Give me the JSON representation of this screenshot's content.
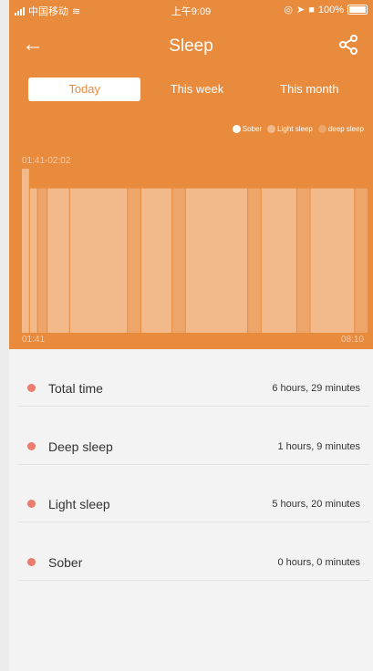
{
  "status_bar": {
    "carrier": "中国移动",
    "time": "上午9:09",
    "battery": "100%"
  },
  "header": {
    "title": "Sleep",
    "back_icon": "arrow-left-icon",
    "share_icon": "share-icon"
  },
  "tabs": [
    {
      "label": "Today",
      "active": true
    },
    {
      "label": "This week",
      "active": false
    },
    {
      "label": "This month",
      "active": false
    }
  ],
  "legend": [
    {
      "label": "Sober",
      "color": "#ffffff"
    },
    {
      "label": "Light sleep",
      "color": "#f2b98b"
    },
    {
      "label": "deep sleep",
      "color": "#eda56a"
    }
  ],
  "chart_data": {
    "type": "bar",
    "x_start": "01:41",
    "x_end": "08:10",
    "selected_range": "01:41-02:02",
    "segments": [
      {
        "state": "Light sleep",
        "start": "01:41",
        "end": "01:50",
        "value": 1.0
      },
      {
        "state": "Light sleep",
        "start": "01:50",
        "end": "01:59",
        "value": 0.88
      },
      {
        "state": "deep sleep",
        "start": "01:59",
        "end": "02:10",
        "value": 0.88
      },
      {
        "state": "Light sleep",
        "start": "02:10",
        "end": "02:35",
        "value": 0.88
      },
      {
        "state": "Light sleep",
        "start": "02:35",
        "end": "03:40",
        "value": 0.88
      },
      {
        "state": "deep sleep",
        "start": "03:40",
        "end": "03:55",
        "value": 0.88
      },
      {
        "state": "Light sleep",
        "start": "03:55",
        "end": "04:30",
        "value": 0.88
      },
      {
        "state": "deep sleep",
        "start": "04:30",
        "end": "04:45",
        "value": 0.88
      },
      {
        "state": "Light sleep",
        "start": "04:45",
        "end": "05:55",
        "value": 0.88
      },
      {
        "state": "deep sleep",
        "start": "05:55",
        "end": "06:10",
        "value": 0.88
      },
      {
        "state": "Light sleep",
        "start": "06:10",
        "end": "06:50",
        "value": 0.88
      },
      {
        "state": "deep sleep",
        "start": "06:50",
        "end": "07:05",
        "value": 0.88
      },
      {
        "state": "Light sleep",
        "start": "07:05",
        "end": "07:55",
        "value": 0.88
      },
      {
        "state": "deep sleep",
        "start": "07:55",
        "end": "08:10",
        "value": 0.88
      }
    ]
  },
  "summary": [
    {
      "label": "Total time",
      "value": "6 hours, 29 minutes"
    },
    {
      "label": "Deep sleep",
      "value": "1 hours, 9 minutes"
    },
    {
      "label": "Light sleep",
      "value": "5 hours, 20 minutes"
    },
    {
      "label": "Sober",
      "value": "0 hours, 0 minutes"
    }
  ],
  "colors": {
    "header": "#e98b3d",
    "bullet": "#ea7b6d"
  }
}
